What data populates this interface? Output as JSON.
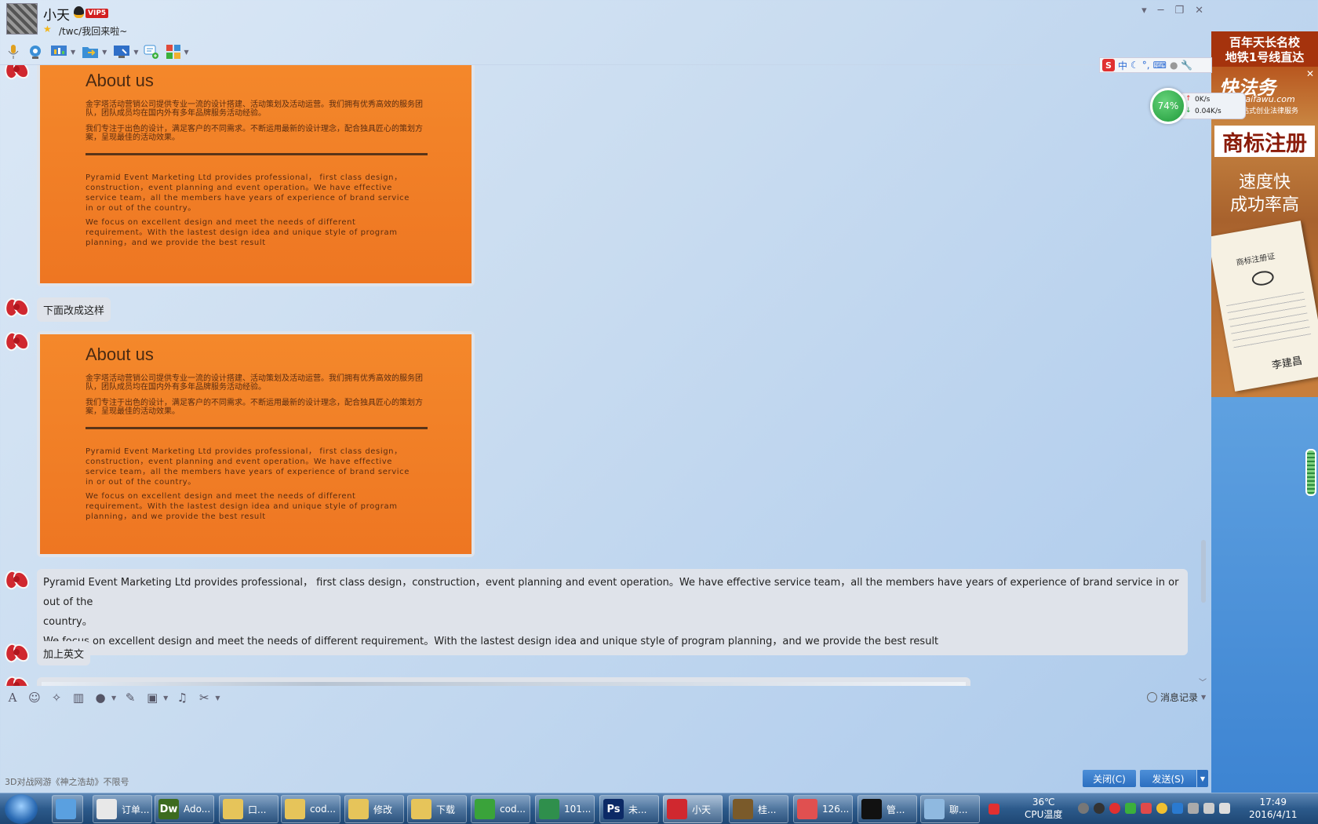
{
  "window": {
    "contact_name": "小天",
    "vip_label": "VIP5",
    "signature": "/twc/我回来啦~"
  },
  "about": {
    "title": "About us",
    "cn_para1": "金字塔活动营销公司提供专业一流的设计搭建、活动策划及活动运营。我们拥有优秀高效的服务团队，团队成员均在国内外有多年品牌服务活动经验。",
    "cn_para2": "我们专注于出色的设计，满足客户的不同需求。不断运用最新的设计理念，配合独具匠心的策划方案，呈现最佳的活动效果。",
    "en_para1": "Pyramid Event Marketing Ltd provides professional， first class design，construction，event planning and event operation。We have effective service team，all the members have years of experience of brand service in or out of the country。",
    "en_para2": "We focus on excellent design and meet the needs of different requirement。With the lastest design idea and unique style of program planning，and we provide the best result"
  },
  "messages": {
    "msg_change": "下面改成这样",
    "long_line1": "Pyramid Event Marketing Ltd provides professional， first class design，construction，event planning and event operation。We have effective service team，all the members have years of experience of brand service in or out of the",
    "long_line2": "country。",
    "long_line3": "We focus on excellent design and meet the needs of different requirement。With the lastest design idea and unique style of program planning，and we provide the best result",
    "msg_add_english": "加上英文"
  },
  "input": {
    "history_label": "消息记录",
    "ad_text": "3D对战网游《神之浩劫》不限号",
    "close_label": "关闭(C)",
    "send_label": "发送(S)"
  },
  "ad_panel": {
    "top_line1": "百年天长名校",
    "top_line2": "地铁1号线直达",
    "brand": "快法务",
    "site": "kuaifawu.com",
    "slogan": "一站式创业法律服务",
    "trademark": "商标注册",
    "fast": "速度快",
    "success": "成功率高",
    "cert_title": "商标注册证",
    "cert_signature": "李建昌"
  },
  "ime": {
    "s_label": "S",
    "mode": "中"
  },
  "speed": {
    "percent": "74%",
    "upload": "0K/s",
    "download": "0.04K/s"
  },
  "taskbar": {
    "tasks": [
      {
        "label": "订单...",
        "color": "#e8e8e8"
      },
      {
        "label": "Ado...",
        "color": "#3d6b1f",
        "glyph": "Dw"
      },
      {
        "label": "口...",
        "color": "#e6c45a"
      },
      {
        "label": "cod...",
        "color": "#e6c45a"
      },
      {
        "label": "修改",
        "color": "#e6c45a"
      },
      {
        "label": "下载",
        "color": "#e6c45a"
      },
      {
        "label": "cod...",
        "color": "#3aa33a"
      },
      {
        "label": "101...",
        "color": "#2f8f4c"
      },
      {
        "label": "未...",
        "color": "#0c2a66",
        "glyph": "Ps"
      },
      {
        "label": "小天",
        "color": "#d0282f"
      },
      {
        "label": "桂...",
        "color": "#7a5a2a"
      },
      {
        "label": "126...",
        "color": "#e05050"
      },
      {
        "label": "管...",
        "color": "#111"
      },
      {
        "label": "聊...",
        "color": "#8fb9e0"
      }
    ],
    "cpu_temp": "36℃",
    "cpu_label": "CPU温度",
    "time": "17:49",
    "date": "2016/4/11"
  }
}
